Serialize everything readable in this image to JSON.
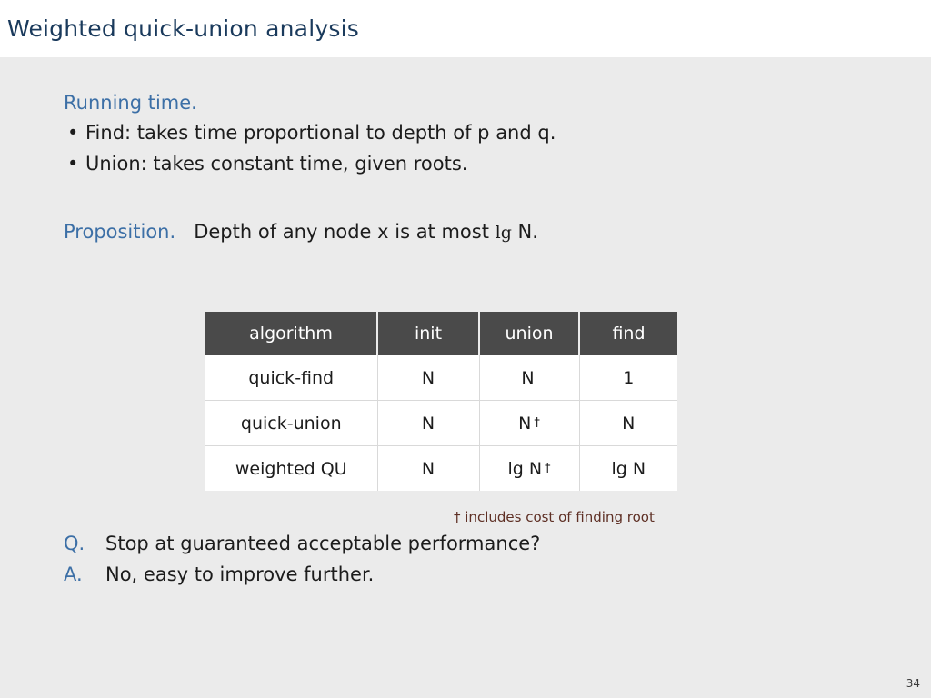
{
  "slide": {
    "title": "Weighted quick-union analysis",
    "page_number": "34",
    "colors": {
      "title": "#1a3a5c",
      "accent_blue": "#3c6fa6",
      "body_text": "#1c1c1c",
      "highlight": "#5e2f24",
      "header_bg": "#ffffff",
      "body_bg": "#ebebeb",
      "table_header_bg": "#4a4a4a"
    }
  },
  "running_time": {
    "heading": "Running time.",
    "bullet_glyph": "•",
    "items": [
      "Find:  takes time proportional to depth of p and q.",
      "Union:  takes constant time, given roots."
    ]
  },
  "proposition": {
    "label": "Proposition.",
    "text_before": "Depth of any node x is at most ",
    "math": "lg",
    "text_after": " N."
  },
  "table": {
    "columns": [
      "algorithm",
      "init",
      "union",
      "find"
    ],
    "rows": [
      {
        "algorithm": "quick-find",
        "init": "N",
        "union": "N",
        "find": "1",
        "union_dagger": "",
        "highlight": false
      },
      {
        "algorithm": "quick-union",
        "init": "N",
        "union": "N",
        "find": "N",
        "union_dagger": "†",
        "highlight": false
      },
      {
        "algorithm": "weighted QU",
        "init": "N",
        "union": "lg N",
        "find": "lg N",
        "union_dagger": "†",
        "highlight": true
      }
    ],
    "footnote": "† includes cost of finding root"
  },
  "qa": {
    "question_label": "Q.",
    "question_text": "Stop at guaranteed acceptable performance?",
    "answer_label": "A.",
    "answer_text": "No, easy to improve further."
  }
}
